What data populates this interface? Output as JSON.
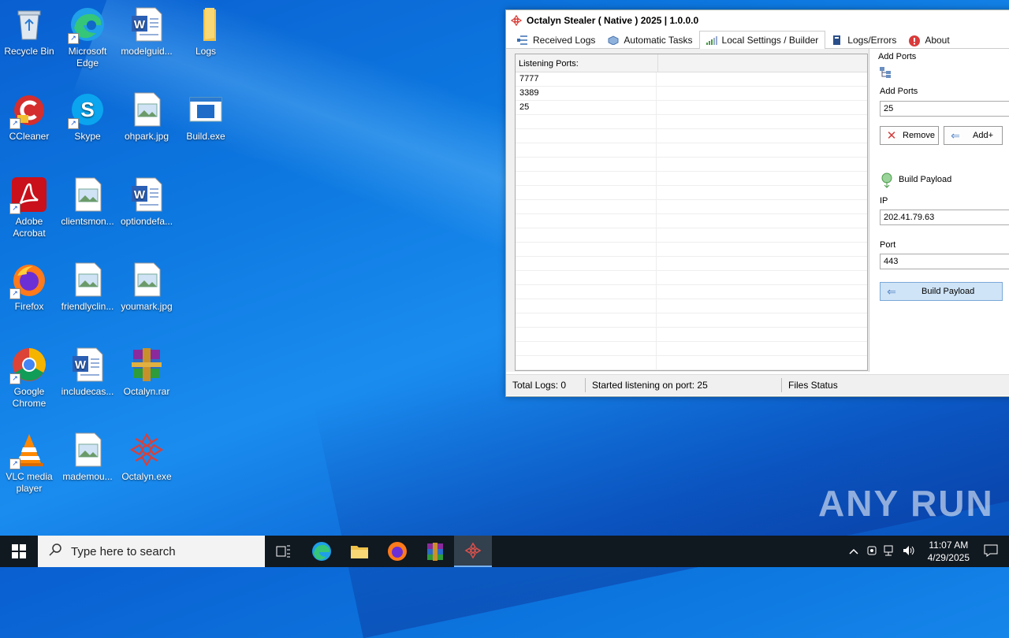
{
  "desktop": {
    "icons": [
      {
        "label": "Recycle Bin"
      },
      {
        "label": "Microsoft Edge"
      },
      {
        "label": "modelguid..."
      },
      {
        "label": "Logs"
      },
      {
        "label": "CCleaner"
      },
      {
        "label": "Skype"
      },
      {
        "label": "ohpark.jpg"
      },
      {
        "label": "Build.exe"
      },
      {
        "label": "Adobe Acrobat"
      },
      {
        "label": "clientsmon..."
      },
      {
        "label": "optiondefa..."
      },
      {
        "label": "Firefox"
      },
      {
        "label": "friendlyclin..."
      },
      {
        "label": "youmark.jpg"
      },
      {
        "label": "Google Chrome"
      },
      {
        "label": "includecas..."
      },
      {
        "label": "Octalyn.rar"
      },
      {
        "label": "VLC media player"
      },
      {
        "label": "mademou..."
      },
      {
        "label": "Octalyn.exe"
      }
    ]
  },
  "window": {
    "title": "Octalyn Stealer ( Native ) 2025 | 1.0.0.0",
    "tabs": [
      {
        "label": "Received Logs"
      },
      {
        "label": "Automatic Tasks"
      },
      {
        "label": "Local Settings / Builder"
      },
      {
        "label": "Logs/Errors"
      },
      {
        "label": "About"
      }
    ],
    "listview": {
      "header": "Listening Ports:",
      "rows": [
        "7777",
        "3389",
        "25"
      ]
    },
    "panel": {
      "group_label": "Add Ports",
      "add_ports_label": "Add Ports",
      "add_ports_value": "25",
      "remove_label": "Remove",
      "add_label": "Add+",
      "build_section_label": "Build Payload",
      "ip_label": "IP",
      "ip_value": "202.41.79.63",
      "port_label": "Port",
      "port_value": "443",
      "build_button_label": "Build Payload"
    },
    "status": {
      "total_logs": "Total Logs: 0",
      "message": "Started listening on port: 25",
      "files_status": "Files Status"
    }
  },
  "watermark": "ANY RUN",
  "taskbar": {
    "search_placeholder": "Type here to search",
    "time": "11:07 AM",
    "date": "4/29/2025"
  }
}
